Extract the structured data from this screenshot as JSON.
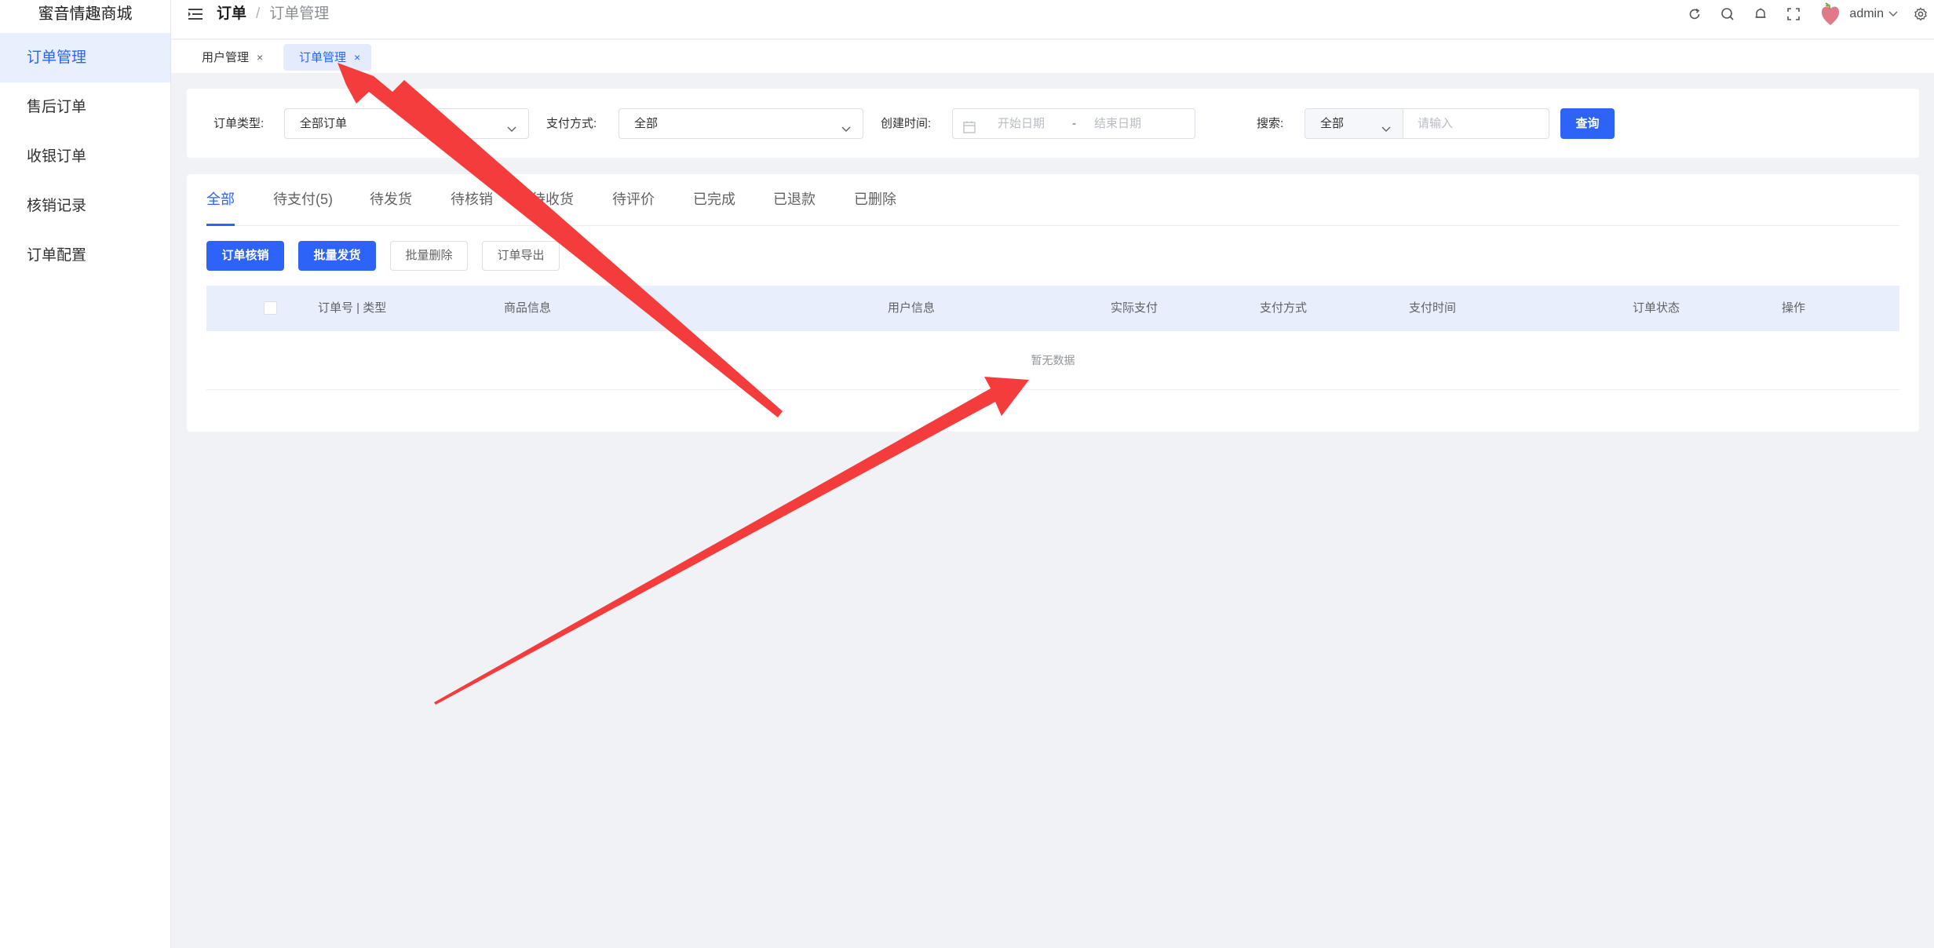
{
  "sidebar": {
    "logo": "蜜音情趣商城",
    "items": [
      {
        "label": "订单管理",
        "active": true
      },
      {
        "label": "售后订单"
      },
      {
        "label": "收银订单"
      },
      {
        "label": "核销记录"
      },
      {
        "label": "订单配置"
      }
    ]
  },
  "header": {
    "breadcrumb": [
      "订单",
      "订单管理"
    ],
    "separator": "/",
    "username": "admin",
    "icons": [
      "refresh-icon",
      "search-icon",
      "bell-icon",
      "fullscreen-icon",
      "avatar",
      "chevron-down-icon",
      "settings-icon"
    ]
  },
  "tags": [
    {
      "label": "用户管理",
      "close": "×"
    },
    {
      "label": "订单管理",
      "close": "×",
      "active": true
    }
  ],
  "filters": {
    "order_type_label": "订单类型:",
    "order_type_value": "全部订单",
    "pay_method_label": "支付方式:",
    "pay_method_value": "全部",
    "created_label": "创建时间:",
    "start_placeholder": "开始日期",
    "range_separator": "-",
    "end_placeholder": "结束日期",
    "search_label": "搜索:",
    "search_scope": "全部",
    "search_placeholder": "请输入",
    "query_button": "查询"
  },
  "tabs": [
    "全部",
    "待支付(5)",
    "待发货",
    "待核销",
    "待收货",
    "待评价",
    "已完成",
    "已退款",
    "已删除"
  ],
  "actions": {
    "verify": "订单核销",
    "batch_ship": "批量发货",
    "batch_delete": "批量删除",
    "export": "订单导出"
  },
  "table": {
    "columns": [
      "订单号 | 类型",
      "商品信息",
      "用户信息",
      "实际支付",
      "支付方式",
      "支付时间",
      "订单状态",
      "操作"
    ],
    "empty_text": "暂无数据"
  },
  "colors": {
    "accent": "#2d63f6",
    "annotation_arrow": "#f53c3c"
  }
}
